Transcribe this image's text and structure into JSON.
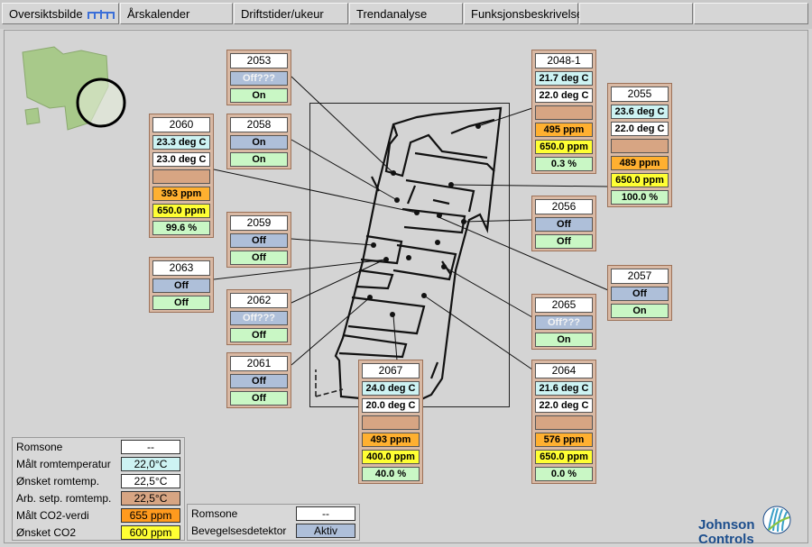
{
  "tabs": [
    "Oversiktsbilde",
    "Årskalender",
    "Driftstider/ukeur",
    "Trendanalyse",
    "Funksjonsbeskrivelse",
    "",
    ""
  ],
  "rooms": {
    "r2053": {
      "name": "2053",
      "motion": "Off???",
      "presence": "On"
    },
    "r2058": {
      "name": "2058",
      "motion": "On",
      "presence": "On"
    },
    "r2059": {
      "name": "2059",
      "motion": "Off",
      "presence": "Off"
    },
    "r2062": {
      "name": "2062",
      "motion": "Off???",
      "presence": "Off"
    },
    "r2061": {
      "name": "2061",
      "motion": "Off",
      "presence": "Off"
    },
    "r2063": {
      "name": "2063",
      "motion": "Off",
      "presence": "Off"
    },
    "r2056": {
      "name": "2056",
      "motion": "Off",
      "presence": "Off"
    },
    "r2065": {
      "name": "2065",
      "motion": "Off???",
      "presence": "On"
    },
    "r2057": {
      "name": "2057",
      "motion": "Off",
      "presence": "On"
    },
    "r2060": {
      "name": "2060",
      "temp": "23.3 deg C",
      "setp": "23.0 deg C",
      "co2": "393 ppm",
      "co2set": "650.0 ppm",
      "pct": "99.6 %"
    },
    "r2048_1": {
      "name": "2048-1",
      "temp": "21.7 deg C",
      "setp": "22.0 deg C",
      "co2": "495 ppm",
      "co2set": "650.0 ppm",
      "pct": "0.3 %"
    },
    "r2055": {
      "name": "2055",
      "temp": "23.6 deg C",
      "setp": "22.0 deg C",
      "co2": "489 ppm",
      "co2set": "650.0 ppm",
      "pct": "100.0 %"
    },
    "r2067": {
      "name": "2067",
      "temp": "24.0 deg C",
      "setp": "20.0 deg C",
      "co2": "493 ppm",
      "co2set": "400.0 ppm",
      "pct": "40.0 %"
    },
    "r2064": {
      "name": "2064",
      "temp": "21.6 deg C",
      "setp": "22.0 deg C",
      "co2": "576 ppm",
      "co2set": "650.0 ppm",
      "pct": "0.0 %"
    }
  },
  "legend_climate": [
    {
      "label": "Romsone",
      "value": "--"
    },
    {
      "label": "Målt romtemperatur",
      "value": "22,0°C"
    },
    {
      "label": "Ønsket romtemp.",
      "value": "22,5°C"
    },
    {
      "label": "Arb. setp. romtemp.",
      "value": "22,5°C"
    },
    {
      "label": "Målt CO2-verdi",
      "value": "655 ppm"
    },
    {
      "label": "Ønsket CO2",
      "value": "600 ppm"
    }
  ],
  "legend_motion": [
    {
      "label": "Romsone",
      "value": "--"
    },
    {
      "label": "Bevegelsesdetektor",
      "value": "Aktiv"
    }
  ],
  "brand": {
    "line1": "Johnson",
    "line2": "Controls"
  },
  "colors": {
    "card_bg": "#d9b9a4",
    "temp_cell": "#cdf3f3",
    "co2_cell": "#ffb030",
    "co2_setpoint_cell": "#ffff33",
    "percent_cell": "#c9f7c5",
    "motion_cell": "#aebfd9",
    "brand_blue": "#1b4d8c"
  }
}
